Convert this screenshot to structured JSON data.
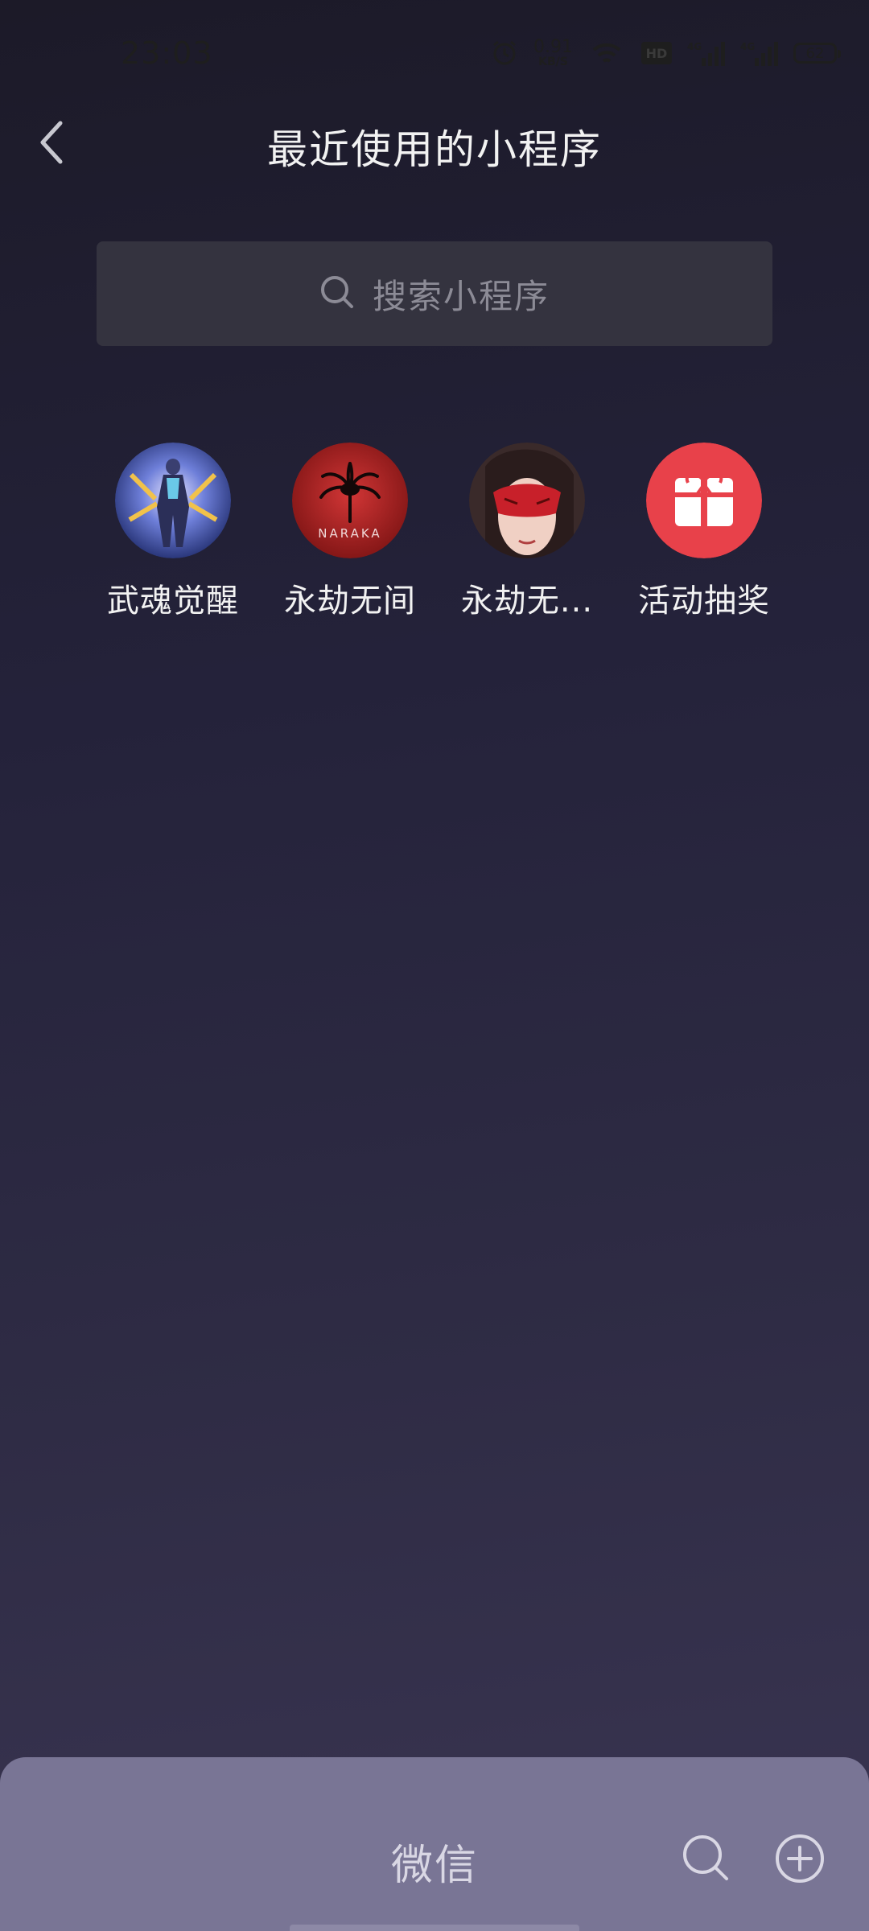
{
  "status_bar": {
    "time": "23:03",
    "speed_value": "0.91",
    "speed_unit": "KB/S",
    "network_1": "4G",
    "network_2": "4G",
    "hd_label": "HD",
    "wifi_label": "5G",
    "battery": "62"
  },
  "header": {
    "title": "最近使用的小程序",
    "back_icon": "chevron-left-icon"
  },
  "search": {
    "placeholder": "搜索小程序",
    "icon": "search-icon"
  },
  "apps": [
    {
      "label": "武魂觉醒",
      "icon": "wuhun-game-icon"
    },
    {
      "label": "永劫无间",
      "icon": "naraka-logo-icon",
      "logo_text": "NARAKA"
    },
    {
      "label": "永劫无...",
      "icon": "masked-character-icon"
    },
    {
      "label": "活动抽奖",
      "icon": "gift-icon"
    }
  ],
  "bottom_bar": {
    "title": "微信",
    "search_icon": "search-icon",
    "add_icon": "add-circle-icon"
  },
  "colors": {
    "bottom_bar": "#797595",
    "search_box": "#34333f",
    "gift_red": "#e8414a"
  }
}
